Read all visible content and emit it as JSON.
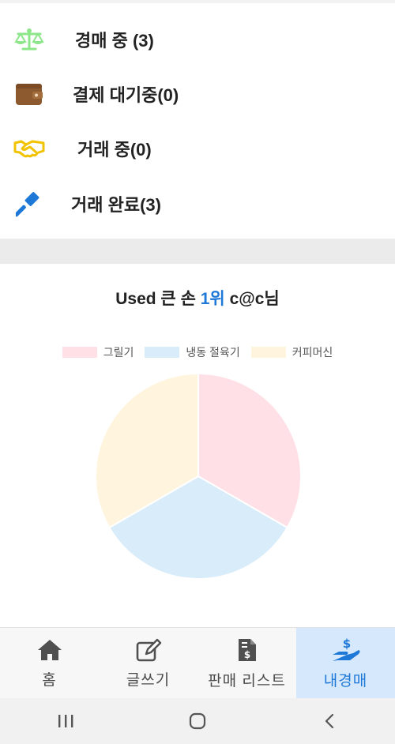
{
  "status_list": [
    {
      "label": "경매 중 (3)",
      "icon": "scale-icon"
    },
    {
      "label": "결제 대기중(0)",
      "icon": "wallet-icon"
    },
    {
      "label": "거래 중(0)",
      "icon": "handshake-icon"
    },
    {
      "label": "거래 완료(3)",
      "icon": "gavel-icon"
    }
  ],
  "ranking": {
    "prefix": "Used 큰 손 ",
    "rank": "1위",
    "suffix": " c@c님"
  },
  "chart_data": {
    "type": "pie",
    "categories": [
      "그릴기",
      "냉동 절육기",
      "커피머신"
    ],
    "values": [
      1,
      1,
      1
    ],
    "colors": [
      "#ffe0e6",
      "#d9ecfa",
      "#fff4dd"
    ],
    "legend_position": "top"
  },
  "bottom_nav": [
    {
      "label": "홈",
      "icon": "home-icon",
      "active": false
    },
    {
      "label": "글쓰기",
      "icon": "edit-icon",
      "active": false
    },
    {
      "label": "판매 리스트",
      "icon": "invoice-icon",
      "active": false
    },
    {
      "label": "내경매",
      "icon": "hand-dollar-icon",
      "active": true
    }
  ],
  "colors": {
    "accent": "#1e78d7",
    "scale": "#8ee68a",
    "wallet": "#8d5a2f",
    "handshake": "#f2c300",
    "gavel": "#1e78d7"
  }
}
